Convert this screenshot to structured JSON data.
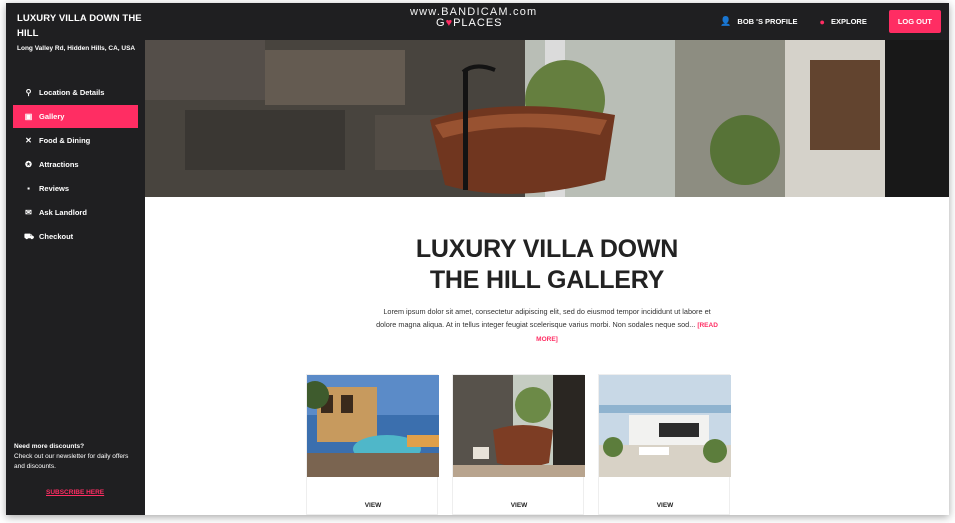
{
  "app": {
    "villa_title": "LUXURY VILLA DOWN THE HILL",
    "villa_address": "Long Valley Rd, Hidden Hills, CA, USA",
    "watermark": "www.BANDICAM.com",
    "logo_left": "G",
    "logo_right": "PLACES"
  },
  "header": {
    "profile_label": "BOB 'S PROFILE",
    "profile_icon": "person-icon",
    "explore_label": "EXPLORE",
    "explore_icon": "compass-icon",
    "logout_label": "LOG OUT",
    "accent": "#ff2d63"
  },
  "sidebar": {
    "items": [
      {
        "label": "Location & Details",
        "icon": "pin-icon",
        "active": false
      },
      {
        "label": "Gallery",
        "icon": "image-icon",
        "active": true
      },
      {
        "label": "Food & Dining",
        "icon": "cutlery-icon",
        "active": false
      },
      {
        "label": "Attractions",
        "icon": "star-icon",
        "active": false
      },
      {
        "label": "Reviews",
        "icon": "review-icon",
        "active": false
      },
      {
        "label": "Ask Landlord",
        "icon": "mail-icon",
        "active": false
      },
      {
        "label": "Checkout",
        "icon": "cart-icon",
        "active": false
      }
    ],
    "promo_head": "Need more discounts?",
    "promo_body": "Check out our newsletter for daily offers and discounts.",
    "subscribe_label": "SUBSCRIBE HERE"
  },
  "main": {
    "title_line1": "LUXURY VILLA DOWN",
    "title_line2": "THE HILL GALLERY",
    "description": "Lorem ipsum dolor sit amet, consectetur adipiscing elit, sed do eiusmod tempor incididunt ut labore et dolore magna aliqua. At in tellus integer feugiat scelerisque varius morbi. Non sodales neque sod...",
    "read_more": "[READ MORE]",
    "cards": [
      {
        "label": "VIEW"
      },
      {
        "label": "VIEW"
      },
      {
        "label": "VIEW"
      }
    ]
  }
}
